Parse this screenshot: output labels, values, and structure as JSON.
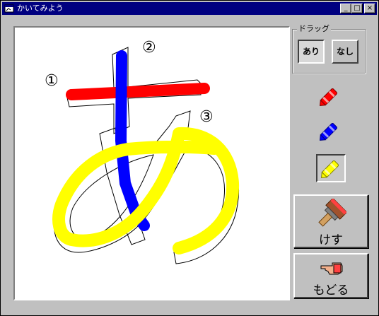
{
  "window": {
    "title": "かいてみよう",
    "minimize_glyph": "_",
    "maximize_glyph": "□",
    "close_glyph": "×"
  },
  "canvas": {
    "character": "あ",
    "stroke_numbers": [
      "①",
      "②",
      "③"
    ],
    "strokes": [
      {
        "color": "#ff0000",
        "label": "stroke-1"
      },
      {
        "color": "#0000ff",
        "label": "stroke-2"
      },
      {
        "color": "#ffff00",
        "label": "stroke-3"
      }
    ]
  },
  "drag_group": {
    "legend": "ドラッグ",
    "options": [
      {
        "label": "あり",
        "selected": true
      },
      {
        "label": "なし",
        "selected": false
      }
    ]
  },
  "crayons": [
    {
      "name": "red-crayon",
      "color": "#ff0000",
      "selected": false
    },
    {
      "name": "blue-crayon",
      "color": "#0000ff",
      "selected": false
    },
    {
      "name": "yellow-crayon",
      "color": "#ffff00",
      "selected": true
    }
  ],
  "buttons": {
    "erase_label": "けす",
    "undo_label": "もどる"
  }
}
